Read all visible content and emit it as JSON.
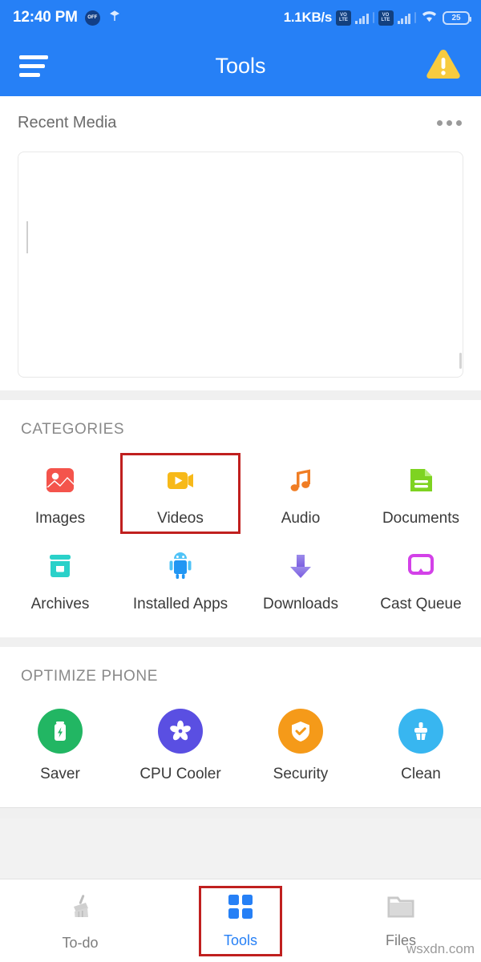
{
  "status_bar": {
    "time": "12:40 PM",
    "dnd_badge": "OFF",
    "network_speed": "1.1KB/s",
    "volte_1": "VO",
    "volte_1b": "LTE",
    "volte_2": "VO",
    "volte_2b": "LTE",
    "battery_level": "25"
  },
  "app_bar": {
    "title": "Tools",
    "menu_icon": "hamburger-menu-icon",
    "warning_icon": "warning-triangle-icon"
  },
  "recent_media": {
    "title": "Recent Media",
    "overflow_icon": "more-options-icon"
  },
  "categories": {
    "title": "CATEGORIES",
    "items": [
      {
        "label": "Images",
        "icon": "images-icon",
        "color": "#f4544c",
        "highlighted": false
      },
      {
        "label": "Videos",
        "icon": "videos-icon",
        "color": "#f7b919",
        "highlighted": true
      },
      {
        "label": "Audio",
        "icon": "audio-icon",
        "color": "#f07d24",
        "highlighted": false
      },
      {
        "label": "Documents",
        "icon": "documents-icon",
        "color": "#7ed321",
        "highlighted": false
      },
      {
        "label": "Archives",
        "icon": "archives-icon",
        "color": "#2ad1c9",
        "highlighted": false
      },
      {
        "label": "Installed Apps",
        "icon": "installed-apps-icon",
        "color": "#2196f3",
        "highlighted": false
      },
      {
        "label": "Downloads",
        "icon": "downloads-icon",
        "color": "#8a6ee0",
        "highlighted": false
      },
      {
        "label": "Cast Queue",
        "icon": "cast-queue-icon",
        "color": "#d341e8",
        "highlighted": false
      }
    ]
  },
  "optimize_phone": {
    "title": "OPTIMIZE PHONE",
    "items": [
      {
        "label": "Saver",
        "icon": "battery-saver-icon",
        "color": "#22b663"
      },
      {
        "label": "CPU Cooler",
        "icon": "cpu-cooler-fan-icon",
        "color": "#5a4fe2"
      },
      {
        "label": "Security",
        "icon": "security-shield-icon",
        "color": "#f59a19"
      },
      {
        "label": "Clean",
        "icon": "clean-brush-icon",
        "color": "#38b6f0"
      }
    ]
  },
  "bottom_nav": {
    "items": [
      {
        "label": "To-do",
        "icon": "todo-broom-icon",
        "active": false,
        "highlighted": false
      },
      {
        "label": "Tools",
        "icon": "tools-grid-icon",
        "active": true,
        "highlighted": true
      },
      {
        "label": "Files",
        "icon": "files-folder-icon",
        "active": false,
        "highlighted": false
      }
    ]
  },
  "watermark": {
    "text": "wsxdn.com"
  },
  "colors": {
    "brand_blue": "#2680f6",
    "highlight_red": "#c0201f",
    "warning_yellow": "#f7cb3f"
  }
}
